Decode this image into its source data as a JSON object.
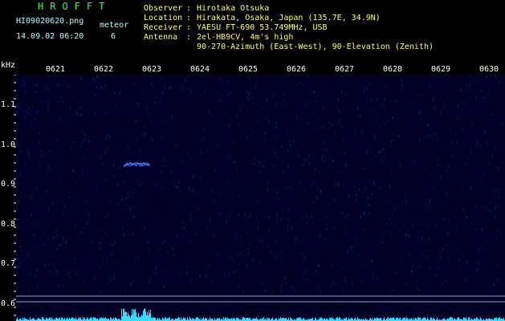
{
  "header": {
    "app_title": "HROFFT",
    "file_name": "HI09020620.png",
    "date_time": "14.09.02 06:20",
    "meteor_label": "meteor",
    "meteor_count": "6"
  },
  "info": [
    {
      "label": "Observer",
      "colon": ":",
      "value": "Hirotaka Otsuka"
    },
    {
      "label": "Location",
      "colon": ":",
      "value": "Hirakata, Osaka, Japan (135.7E, 34.9N)"
    },
    {
      "label": "Receiver",
      "colon": ":",
      "value": "YAESU FT-690 53.749MHz, USB"
    },
    {
      "label": "Antenna",
      "colon": ":",
      "value": "2el-HB9CV, 4m's high"
    },
    {
      "label": "",
      "colon": "",
      "value": "90-270-Azimuth (East-West), 90-Elevation (Zenith)"
    }
  ],
  "axis": {
    "y_unit": "kHz",
    "y_ticks": [
      "1.1",
      "1.0",
      "0.9",
      "0.8",
      "0.7",
      "0.6"
    ],
    "x_ticks": [
      "0621",
      "0622",
      "0623",
      "0624",
      "0625",
      "0626",
      "0627",
      "0628",
      "0629",
      "0630"
    ]
  },
  "colors": {
    "background": "#000000",
    "plot_background": "#000026",
    "noise": "#1a2a8a",
    "echo": "#3a7aff",
    "spectrum": "#33ddff",
    "text_white": "#ffffff",
    "text_yellow": "#ffff66",
    "title_green": "#33ff33"
  }
}
